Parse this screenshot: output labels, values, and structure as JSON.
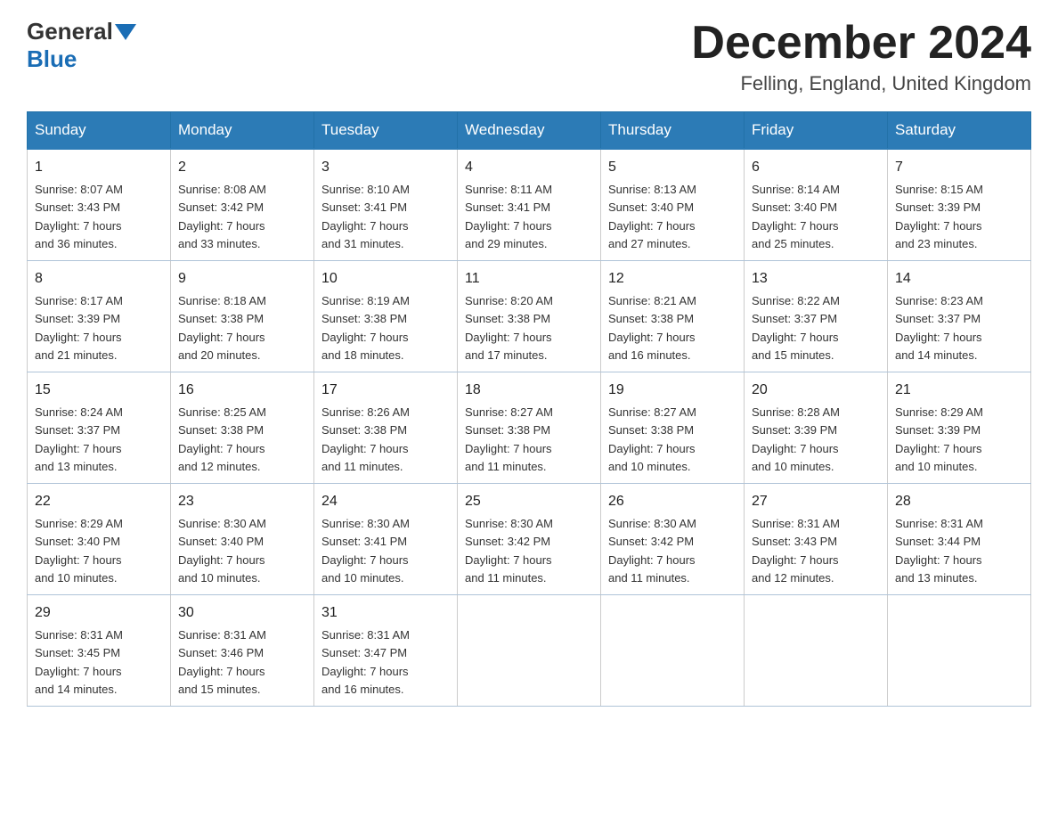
{
  "header": {
    "logo_general": "General",
    "logo_blue": "Blue",
    "month_year": "December 2024",
    "location": "Felling, England, United Kingdom"
  },
  "days_of_week": [
    "Sunday",
    "Monday",
    "Tuesday",
    "Wednesday",
    "Thursday",
    "Friday",
    "Saturday"
  ],
  "weeks": [
    [
      {
        "num": "1",
        "sunrise": "8:07 AM",
        "sunset": "3:43 PM",
        "daylight": "7 hours and 36 minutes."
      },
      {
        "num": "2",
        "sunrise": "8:08 AM",
        "sunset": "3:42 PM",
        "daylight": "7 hours and 33 minutes."
      },
      {
        "num": "3",
        "sunrise": "8:10 AM",
        "sunset": "3:41 PM",
        "daylight": "7 hours and 31 minutes."
      },
      {
        "num": "4",
        "sunrise": "8:11 AM",
        "sunset": "3:41 PM",
        "daylight": "7 hours and 29 minutes."
      },
      {
        "num": "5",
        "sunrise": "8:13 AM",
        "sunset": "3:40 PM",
        "daylight": "7 hours and 27 minutes."
      },
      {
        "num": "6",
        "sunrise": "8:14 AM",
        "sunset": "3:40 PM",
        "daylight": "7 hours and 25 minutes."
      },
      {
        "num": "7",
        "sunrise": "8:15 AM",
        "sunset": "3:39 PM",
        "daylight": "7 hours and 23 minutes."
      }
    ],
    [
      {
        "num": "8",
        "sunrise": "8:17 AM",
        "sunset": "3:39 PM",
        "daylight": "7 hours and 21 minutes."
      },
      {
        "num": "9",
        "sunrise": "8:18 AM",
        "sunset": "3:38 PM",
        "daylight": "7 hours and 20 minutes."
      },
      {
        "num": "10",
        "sunrise": "8:19 AM",
        "sunset": "3:38 PM",
        "daylight": "7 hours and 18 minutes."
      },
      {
        "num": "11",
        "sunrise": "8:20 AM",
        "sunset": "3:38 PM",
        "daylight": "7 hours and 17 minutes."
      },
      {
        "num": "12",
        "sunrise": "8:21 AM",
        "sunset": "3:38 PM",
        "daylight": "7 hours and 16 minutes."
      },
      {
        "num": "13",
        "sunrise": "8:22 AM",
        "sunset": "3:37 PM",
        "daylight": "7 hours and 15 minutes."
      },
      {
        "num": "14",
        "sunrise": "8:23 AM",
        "sunset": "3:37 PM",
        "daylight": "7 hours and 14 minutes."
      }
    ],
    [
      {
        "num": "15",
        "sunrise": "8:24 AM",
        "sunset": "3:37 PM",
        "daylight": "7 hours and 13 minutes."
      },
      {
        "num": "16",
        "sunrise": "8:25 AM",
        "sunset": "3:38 PM",
        "daylight": "7 hours and 12 minutes."
      },
      {
        "num": "17",
        "sunrise": "8:26 AM",
        "sunset": "3:38 PM",
        "daylight": "7 hours and 11 minutes."
      },
      {
        "num": "18",
        "sunrise": "8:27 AM",
        "sunset": "3:38 PM",
        "daylight": "7 hours and 11 minutes."
      },
      {
        "num": "19",
        "sunrise": "8:27 AM",
        "sunset": "3:38 PM",
        "daylight": "7 hours and 10 minutes."
      },
      {
        "num": "20",
        "sunrise": "8:28 AM",
        "sunset": "3:39 PM",
        "daylight": "7 hours and 10 minutes."
      },
      {
        "num": "21",
        "sunrise": "8:29 AM",
        "sunset": "3:39 PM",
        "daylight": "7 hours and 10 minutes."
      }
    ],
    [
      {
        "num": "22",
        "sunrise": "8:29 AM",
        "sunset": "3:40 PM",
        "daylight": "7 hours and 10 minutes."
      },
      {
        "num": "23",
        "sunrise": "8:30 AM",
        "sunset": "3:40 PM",
        "daylight": "7 hours and 10 minutes."
      },
      {
        "num": "24",
        "sunrise": "8:30 AM",
        "sunset": "3:41 PM",
        "daylight": "7 hours and 10 minutes."
      },
      {
        "num": "25",
        "sunrise": "8:30 AM",
        "sunset": "3:42 PM",
        "daylight": "7 hours and 11 minutes."
      },
      {
        "num": "26",
        "sunrise": "8:30 AM",
        "sunset": "3:42 PM",
        "daylight": "7 hours and 11 minutes."
      },
      {
        "num": "27",
        "sunrise": "8:31 AM",
        "sunset": "3:43 PM",
        "daylight": "7 hours and 12 minutes."
      },
      {
        "num": "28",
        "sunrise": "8:31 AM",
        "sunset": "3:44 PM",
        "daylight": "7 hours and 13 minutes."
      }
    ],
    [
      {
        "num": "29",
        "sunrise": "8:31 AM",
        "sunset": "3:45 PM",
        "daylight": "7 hours and 14 minutes."
      },
      {
        "num": "30",
        "sunrise": "8:31 AM",
        "sunset": "3:46 PM",
        "daylight": "7 hours and 15 minutes."
      },
      {
        "num": "31",
        "sunrise": "8:31 AM",
        "sunset": "3:47 PM",
        "daylight": "7 hours and 16 minutes."
      },
      null,
      null,
      null,
      null
    ]
  ],
  "labels": {
    "sunrise": "Sunrise:",
    "sunset": "Sunset:",
    "daylight": "Daylight:"
  }
}
